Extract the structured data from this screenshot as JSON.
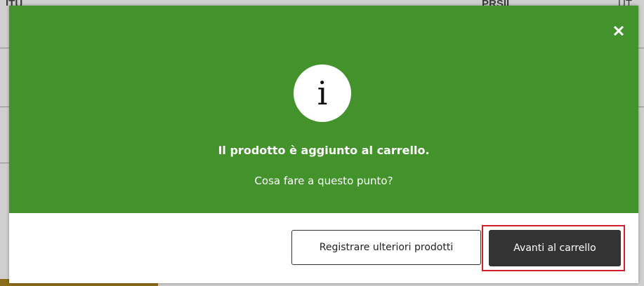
{
  "background": {
    "left_heading": "ITU",
    "mid_heading": "PRSII",
    "right_heading": "UT"
  },
  "modal": {
    "close_icon": "close-icon",
    "info_icon": "info-icon",
    "info_glyph": "i",
    "title": "Il prodotto è aggiunto al carrello.",
    "subtitle": "Cosa fare a questo punto?",
    "secondary_button": "Registrare ulteriori prodotti",
    "primary_button": "Avanti al carrello",
    "colors": {
      "header_bg": "#43922c",
      "primary_button_bg": "#333333",
      "highlight": "#d11f2b"
    }
  }
}
